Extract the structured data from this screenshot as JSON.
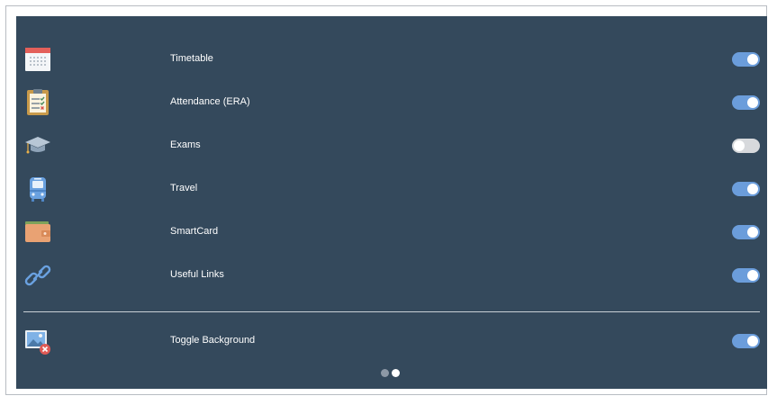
{
  "settings": {
    "items": [
      {
        "label": "Timetable",
        "icon": "calendar-icon",
        "enabled": true
      },
      {
        "label": "Attendance (ERA)",
        "icon": "clipboard-checklist-icon",
        "enabled": true
      },
      {
        "label": "Exams",
        "icon": "graduation-cap-icon",
        "enabled": false
      },
      {
        "label": "Travel",
        "icon": "bus-icon",
        "enabled": true
      },
      {
        "label": "SmartCard",
        "icon": "wallet-icon",
        "enabled": true
      },
      {
        "label": "Useful Links",
        "icon": "link-icon",
        "enabled": true
      }
    ],
    "background_toggle": {
      "label": "Toggle Background",
      "icon": "image-remove-icon",
      "enabled": true
    }
  },
  "pagination": {
    "pages": 2,
    "current": 2
  },
  "colors": {
    "panel": "#34495c",
    "toggle_on": "#6b9ddb",
    "toggle_off": "#d7d9dc",
    "text": "#ffffff"
  }
}
